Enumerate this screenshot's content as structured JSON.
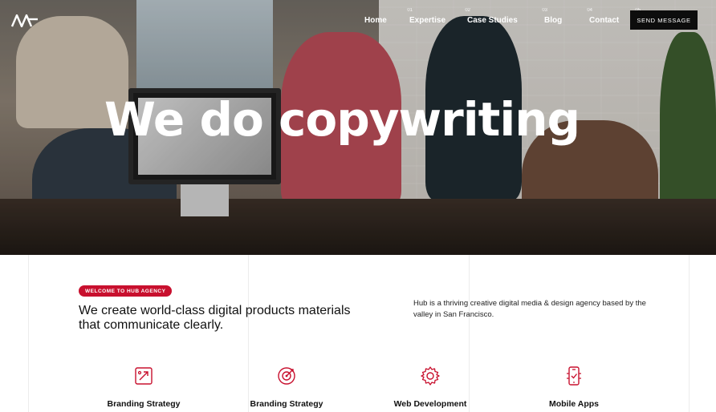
{
  "nav": {
    "items": [
      {
        "label": "Home",
        "num": "01"
      },
      {
        "label": "Expertise",
        "num": "02"
      },
      {
        "label": "Case Studies",
        "num": "03"
      },
      {
        "label": "Blog",
        "num": "04"
      },
      {
        "label": "Contact",
        "num": "05"
      }
    ],
    "cta": "SEND MESSAGE"
  },
  "hero": {
    "title": "We do copywriting"
  },
  "intro": {
    "badge": "WELCOME TO HUB AGENCY",
    "headline": "We create world-class digital products materials that communicate clearly.",
    "description": "Hub is a thriving creative digital media & design agency based by the valley in San Francisco."
  },
  "services": [
    {
      "label": "Branding Strategy",
      "icon": "branding-icon"
    },
    {
      "label": "Branding Strategy",
      "icon": "target-icon"
    },
    {
      "label": "Web Development",
      "icon": "gear-icon"
    },
    {
      "label": "Mobile Apps",
      "icon": "mobile-icon"
    }
  ],
  "colors": {
    "accent": "#c8102e",
    "button": "#0d0d0d"
  }
}
